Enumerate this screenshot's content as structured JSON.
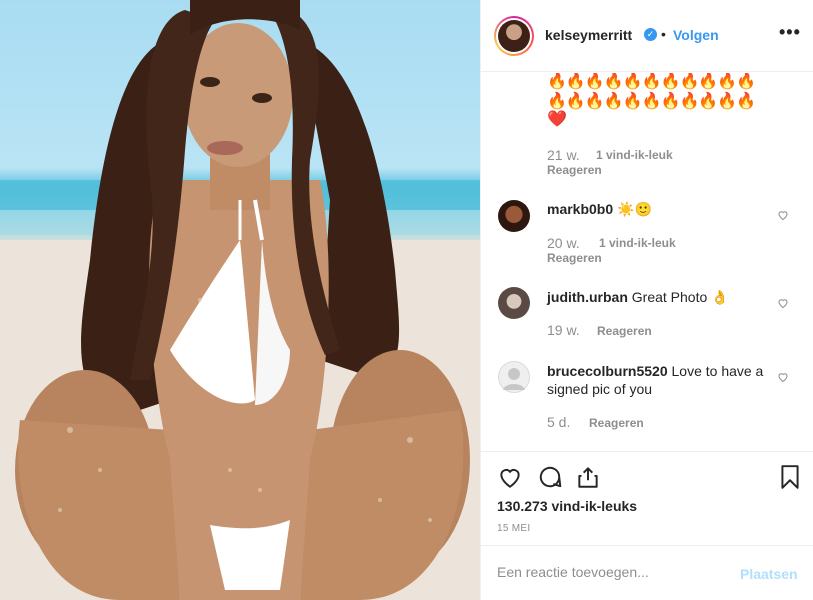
{
  "post_owner": {
    "username": "kelseymerritt",
    "verified_icon": "verified-badge-icon",
    "separator": "•",
    "follow_label": "Volgen",
    "more_icon": "more-options-icon",
    "more_glyph": "•••"
  },
  "caption_tail": {
    "emoji_line_1": "🔥🔥🔥🔥🔥🔥🔥🔥🔥🔥🔥",
    "emoji_line_2": "🔥🔥🔥🔥🔥🔥🔥🔥🔥🔥🔥",
    "emoji_line_3": "❤️",
    "time": "21 w.",
    "likes": "1 vind-ik-leuk",
    "reply": "Reageren"
  },
  "comments": [
    {
      "user": "markb0b0",
      "text": "☀️🙂",
      "time": "20 w.",
      "likes": "1 vind-ik-leuk",
      "reply": "Reageren",
      "avatar_color": "#6b3a2a"
    },
    {
      "user": "judith.urban",
      "text": "Great Photo 👌",
      "time": "19 w.",
      "likes": "",
      "reply": "Reageren",
      "avatar_color": "#b9b2ad"
    },
    {
      "user": "brucecolburn5520",
      "text": "Love to have a signed pic of you",
      "time": "5 d.",
      "likes": "",
      "reply": "Reageren",
      "avatar_color": "#dbdbdb"
    }
  ],
  "actions": {
    "like_icon": "heart-icon",
    "comment_icon": "comment-icon",
    "share_icon": "share-icon",
    "save_icon": "bookmark-icon",
    "likes_count": "130.273 vind-ik-leuks",
    "date": "15 MEI"
  },
  "add_comment": {
    "placeholder": "Een reactie toevoegen...",
    "post_label": "Plaatsen"
  },
  "colors": {
    "accent": "#3897f0",
    "post_disabled": "#b2dffc",
    "muted": "#8e8e8e"
  }
}
